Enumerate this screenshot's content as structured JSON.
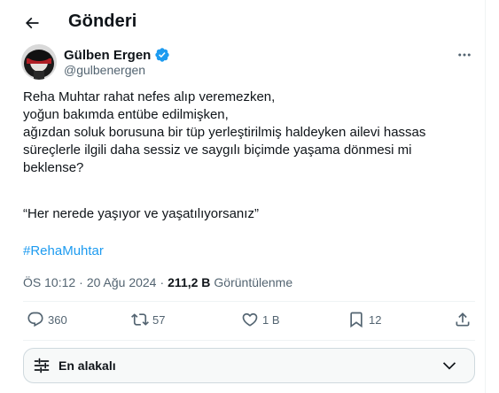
{
  "header": {
    "title": "Gönderi",
    "back_icon": "arrow-left-icon"
  },
  "author": {
    "name": "Gülben Ergen",
    "handle": "@gulbenergen",
    "verified_icon": "verified-badge-icon",
    "verified_color": "#1d9bf0"
  },
  "tweet": {
    "lines": [
      "Reha Muhtar rahat nefes alıp veremezken,",
      "yoğun bakımda entübe edilmişken,",
      "ağızdan soluk borusuna bir tüp yerleştirilmiş haldeyken ailevi hassas",
      "süreçlerle ilgili daha sessiz ve saygılı biçimde yaşama dönmesi mi",
      "beklense?"
    ],
    "quote": "“Her nerede yaşıyor ve yaşatılıyorsanız”",
    "hashtag": "#RehaMuhtar",
    "time": "ÖS 10:12",
    "date": "20 Ağu 2024",
    "views_count": "211,2 B",
    "views_label": "Görüntülenme"
  },
  "actions": {
    "replies": "360",
    "reposts": "57",
    "likes": "1 B",
    "bookmarks": "12"
  },
  "sort": {
    "label": "En alakalı"
  },
  "colors": {
    "accent": "#1d9bf0",
    "text_secondary": "#536471",
    "border": "#eff3f4"
  }
}
